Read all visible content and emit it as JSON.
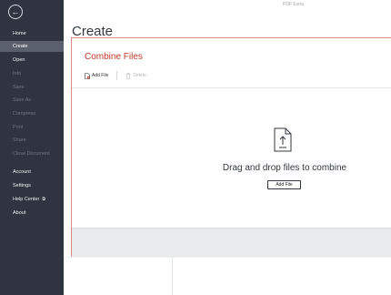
{
  "app": {
    "title": "PDF Extra"
  },
  "sidebar": {
    "back_label": "←",
    "items": [
      {
        "label": "Home",
        "state": "normal"
      },
      {
        "label": "Create",
        "state": "active"
      },
      {
        "label": "Open",
        "state": "normal"
      },
      {
        "label": "Info",
        "state": "disabled"
      },
      {
        "label": "Save",
        "state": "disabled"
      },
      {
        "label": "Save As",
        "state": "disabled"
      },
      {
        "label": "Compress",
        "state": "disabled"
      },
      {
        "label": "Print",
        "state": "disabled"
      },
      {
        "label": "Share",
        "state": "disabled"
      },
      {
        "label": "Close Document",
        "state": "disabled"
      },
      {
        "label": "Account",
        "state": "normal"
      },
      {
        "label": "Settings",
        "state": "normal"
      },
      {
        "label": "Help Center",
        "state": "normal",
        "external_icon": "⧉"
      },
      {
        "label": "About",
        "state": "normal"
      }
    ]
  },
  "main": {
    "page_title": "Create",
    "panel": {
      "title": "Combine Files",
      "toolbar": {
        "add_file": "Add File",
        "delete": "Delete"
      },
      "drop_text": "Drag and drop files to combine",
      "add_button": "Add File"
    }
  },
  "colors": {
    "sidebar_bg": "#2f3440",
    "sidebar_active": "#5b616c",
    "accent": "#c0392b"
  }
}
